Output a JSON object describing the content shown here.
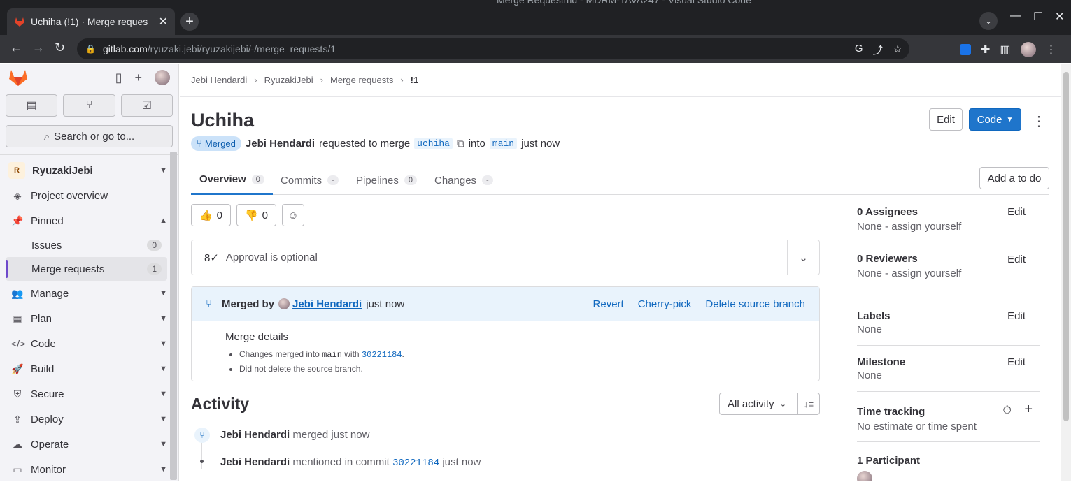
{
  "browser": {
    "tab_title": "Uchiha (!1) · Merge reques",
    "window_title": "Merge Requestmd - MDRM-TAVA247 - Visual Studio Code",
    "url_host": "gitlab.com",
    "url_path": "/ryuzaki.jebi/ryuzakijebi/-/merge_requests/1"
  },
  "sidebar": {
    "search_label": "Search or go to...",
    "project_initial": "R",
    "project_name": "RyuzakiJebi",
    "items": {
      "overview": "Project overview",
      "pinned": "Pinned",
      "issues": "Issues",
      "issues_count": "0",
      "mrs": "Merge requests",
      "mrs_count": "1",
      "manage": "Manage",
      "plan": "Plan",
      "code": "Code",
      "build": "Build",
      "secure": "Secure",
      "deploy": "Deploy",
      "operate": "Operate",
      "monitor": "Monitor"
    }
  },
  "breadcrumb": [
    "Jebi Hendardi",
    "RyuzakiJebi",
    "Merge requests",
    "!1"
  ],
  "mr": {
    "title": "Uchiha",
    "edit_label": "Edit",
    "code_label": "Code",
    "status": "Merged",
    "author": "Jebi Hendardi",
    "requested_text": "requested to merge",
    "source_branch": "uchiha",
    "into_text": "into",
    "target_branch": "main",
    "time": "just now"
  },
  "tabs": {
    "overview": "Overview",
    "overview_count": "0",
    "commits": "Commits",
    "commits_count": "-",
    "pipelines": "Pipelines",
    "pipelines_count": "0",
    "changes": "Changes",
    "changes_count": "-",
    "todo": "Add a to do"
  },
  "reactions": {
    "thumbs_up": "0",
    "thumbs_down": "0"
  },
  "approval": {
    "text": "Approval is optional"
  },
  "merge_widget": {
    "merged_by_label": "Merged by",
    "user": "Jebi Hendardi",
    "time": "just now",
    "revert": "Revert",
    "cherry_pick": "Cherry-pick",
    "delete_branch": "Delete source branch",
    "details_title": "Merge details",
    "detail1_prefix": "Changes merged into",
    "detail1_branch": "main",
    "detail1_with": "with",
    "detail1_commit": "30221184",
    "detail2": "Did not delete the source branch."
  },
  "activity": {
    "title": "Activity",
    "filter": "All activity",
    "events": [
      {
        "user": "Jebi Hendardi",
        "text": "merged just now"
      },
      {
        "user": "Jebi Hendardi",
        "text": "mentioned in commit",
        "commit": "30221184",
        "time": "just now"
      }
    ]
  },
  "right_sidebar": {
    "assignees": "0 Assignees",
    "assignees_val": "None - assign yourself",
    "reviewers": "0 Reviewers",
    "reviewers_val": "None - assign yourself",
    "labels": "Labels",
    "labels_val": "None",
    "milestone": "Milestone",
    "milestone_val": "None",
    "time_tracking": "Time tracking",
    "time_val": "No estimate or time spent",
    "participants": "1 Participant",
    "edit": "Edit"
  },
  "colors": {
    "accent": "#1f75cb",
    "merged_badge": "#cbe2f9",
    "sidebar_bg": "#f3f3f7"
  }
}
